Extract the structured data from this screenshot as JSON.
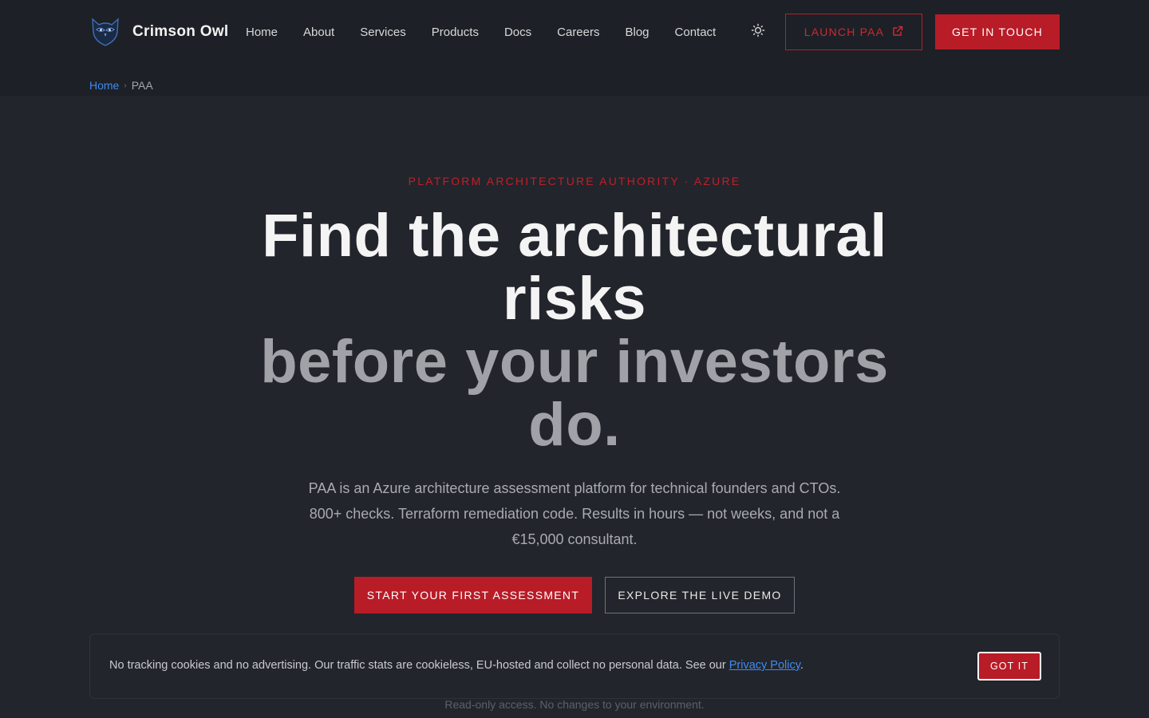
{
  "brand": {
    "name": "Crimson Owl",
    "logo_icon": "owl-logo-icon"
  },
  "nav": {
    "items": [
      "Home",
      "About",
      "Services",
      "Products",
      "Docs",
      "Careers",
      "Blog",
      "Contact"
    ],
    "theme_icon": "sun-icon"
  },
  "header": {
    "launch_label": "LAUNCH PAA",
    "launch_icon": "external-link-icon",
    "contact_label": "GET IN TOUCH"
  },
  "breadcrumb": {
    "home": "Home",
    "separator": "›",
    "current": "PAA"
  },
  "hero": {
    "eyebrow": "PLATFORM ARCHITECTURE AUTHORITY · AZURE",
    "headline_line1": "Find the architectural risks",
    "headline_line2": "before your investors do.",
    "lead": "PAA is an Azure architecture assessment platform for technical founders and CTOs. 800+ checks. Terraform remediation code. Results in hours — not weeks, and not a €15,000 consultant.",
    "cta_primary": "START YOUR FIRST ASSESSMENT",
    "cta_secondary": "EXPLORE THE LIVE DEMO",
    "note": "Read-only access. No changes to your environment."
  },
  "cookie": {
    "text_before": "No tracking cookies and no advertising. Our traffic stats are cookieless, EU-hosted and collect no personal data. See our ",
    "link": "Privacy Policy",
    "text_after": ".",
    "button": "GOT IT"
  },
  "colors": {
    "accent": "#b81c27",
    "link": "#3d8bf0",
    "background": "#22252b",
    "header_bg": "#1d2026"
  }
}
